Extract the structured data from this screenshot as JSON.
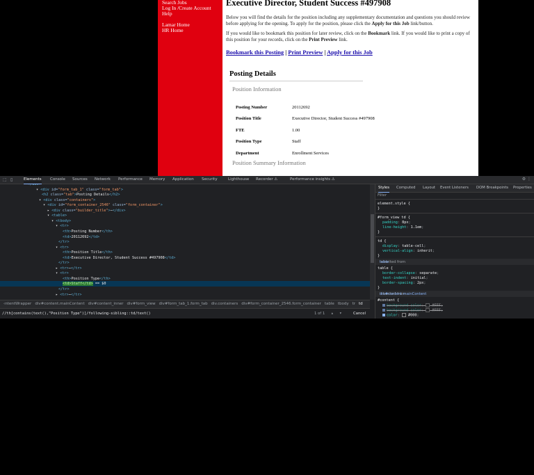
{
  "page": {
    "nav": [
      "Search Jobs",
      "Log In /Create Account",
      "Help",
      "",
      "Lamar Home",
      "HR Home"
    ],
    "title": "Executive Director, Student Success #497908",
    "intro1": "Below you will find the details for the position including any supplementary documentation and questions you should review before applying for the opening.  To apply for the position, please click the ",
    "intro1_bold": "Apply for this Job",
    "intro1_end": " link/button.",
    "intro2a": "If you would like to bookmark this position for later review, click on the ",
    "intro2_bold1": "Bookmark",
    "intro2b": " link.  If you would like to print a copy of this position for your records, click on the ",
    "intro2_bold2": "Print Preview",
    "intro2c": " link.",
    "links": [
      "Bookmark this Posting",
      "Print Preview",
      "Apply for this Job"
    ],
    "link_sep": "|",
    "posting_details": "Posting Details",
    "position_information": "Position Information",
    "rows": [
      {
        "k": "Posting Number",
        "v": "20112692"
      },
      {
        "k": "Position Title",
        "v": "Executive Director, Student Success #497908"
      },
      {
        "k": "FTE",
        "v": "1.00"
      },
      {
        "k": "Position Type",
        "v": "Staff"
      },
      {
        "k": "Department",
        "v": "Enrollment Services"
      }
    ],
    "position_summary": "Position Summary Information"
  },
  "devtools": {
    "tabs": [
      "Elements",
      "Console",
      "Sources",
      "Network",
      "Performance",
      "Memory",
      "Application",
      "Security",
      "Lighthouse",
      "Recorder ⚠",
      "Performance insights ⚠"
    ],
    "active_tab": "Elements",
    "tree": [
      {
        "indent": 40,
        "html": "partial"
      },
      {
        "indent": 52,
        "t": "▾",
        "open": "div",
        "attrs": [
          [
            "id",
            "form_tab_1"
          ],
          [
            "class",
            "form_tab"
          ]
        ]
      },
      {
        "indent": 60,
        "t": " ",
        "open": "h2",
        "attrs": [
          [
            "class",
            "tab"
          ]
        ],
        "text": "Posting Details",
        "close": "h2"
      },
      {
        "indent": 56,
        "t": "▾",
        "open": "div",
        "attrs": [
          [
            "class",
            "containers"
          ]
        ]
      },
      {
        "indent": 62,
        "t": "▾",
        "open": "div",
        "attrs": [
          [
            "id",
            "form_container_2546"
          ],
          [
            "class",
            "form_container"
          ]
        ]
      },
      {
        "indent": 68,
        "t": "▸",
        "open": "div",
        "attrs": [
          [
            "class",
            "builder_title"
          ]
        ],
        "text": "⋯",
        "close": "div"
      },
      {
        "indent": 68,
        "t": "▾",
        "open": "table"
      },
      {
        "indent": 74,
        "t": "▾",
        "open": "tbody"
      },
      {
        "indent": 80,
        "t": "▾",
        "open": "tr"
      },
      {
        "indent": 90,
        "t": " ",
        "open": "th",
        "text": "Posting Number",
        "close": "th"
      },
      {
        "indent": 90,
        "t": " ",
        "open": "td",
        "text": "20112692",
        "close": "td"
      },
      {
        "indent": 84,
        "t": " ",
        "closeonly": "tr"
      },
      {
        "indent": 80,
        "t": "▾",
        "open": "tr"
      },
      {
        "indent": 90,
        "t": " ",
        "open": "th",
        "text": "Position Title",
        "close": "th"
      },
      {
        "indent": 90,
        "t": " ",
        "open": "td",
        "text": "Executive Director, Student Success #497908",
        "close": "td"
      },
      {
        "indent": 84,
        "t": " ",
        "closeonly": "tr"
      },
      {
        "indent": 80,
        "t": "▸",
        "open": "tr",
        "text": "⋯",
        "close": "tr"
      },
      {
        "indent": 80,
        "t": "▾",
        "open": "tr"
      },
      {
        "indent": 90,
        "t": " ",
        "open": "th",
        "text": "Position Type",
        "close": "th"
      },
      {
        "indent": 90,
        "t": " ",
        "selected": true,
        "hl": "<td>Staff</td>",
        "suffix": "== $0"
      },
      {
        "indent": 84,
        "t": " ",
        "closeonly": "tr"
      },
      {
        "indent": 80,
        "t": "▸",
        "open": "tr",
        "text": "⋯",
        "close": "tr"
      }
    ],
    "breadcrumb": [
      "‹ntentWrapper",
      "div#content.mainContent",
      "div#content_inner",
      "div#form_view",
      "div#form_tab_1.form_tab",
      "div.containers",
      "div#form_container_2546.form_container",
      "table",
      "tbody",
      "tr",
      "td"
    ],
    "search_query": "//th[contains(text(),\"Position Type\")]/following-sibling::td/text()",
    "search_count": "1 of 1",
    "search_cancel": "Cancel",
    "styles_tabs": [
      "Styles",
      "Computed",
      "Layout",
      "Event Listeners",
      "DOM Breakpoints",
      "Properties"
    ],
    "filter_placeholder": "Filter",
    "element_style": "element.style {",
    "rule1_sel": "#form_view td {",
    "rule1_props": [
      [
        "padding",
        "8px"
      ],
      [
        "line-height",
        "1.1em"
      ]
    ],
    "rule2_sel": "td {",
    "rule2_props": [
      [
        "display",
        "table-cell"
      ],
      [
        "vertical-align",
        "inherit"
      ]
    ],
    "inh1_label": "Inherited from ",
    "inh1_link": "table",
    "rule3_sel": "table {",
    "rule3_props": [
      [
        "border-collapse",
        "separate"
      ],
      [
        "text-indent",
        "initial"
      ],
      [
        "border-spacing",
        "2px"
      ]
    ],
    "inh2_label": "Inherited from ",
    "inh2_link": "div#content.mainContent",
    "rule4_sel": "#content {",
    "rule4_props": [
      [
        "background-color",
        "#FFF"
      ],
      [
        "background-color",
        "#FFF"
      ],
      [
        "color",
        "#000"
      ]
    ],
    "brace_close": "}",
    "colon": ":",
    "semicolon": ";"
  }
}
